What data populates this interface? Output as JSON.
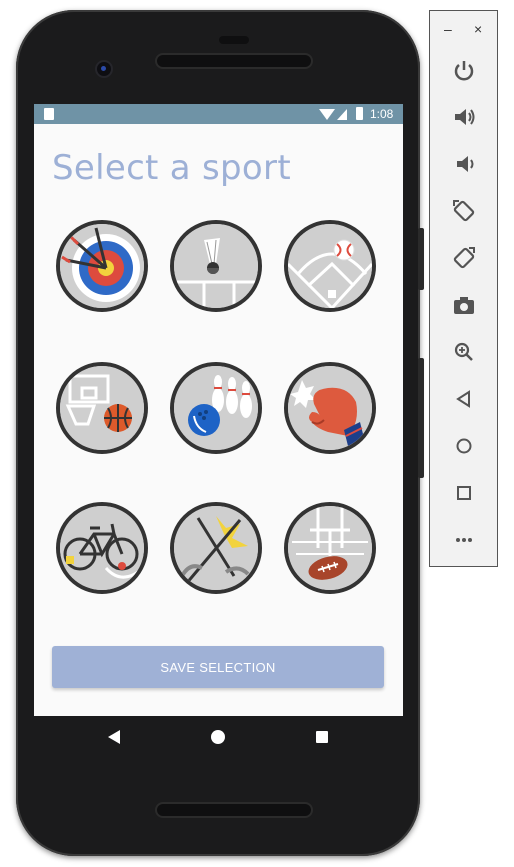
{
  "status_bar": {
    "time": "1:08"
  },
  "page": {
    "title": "Select a sport"
  },
  "sports": [
    {
      "name": "archery"
    },
    {
      "name": "badminton"
    },
    {
      "name": "baseball"
    },
    {
      "name": "basketball"
    },
    {
      "name": "bowling"
    },
    {
      "name": "boxing"
    },
    {
      "name": "cycling"
    },
    {
      "name": "fencing"
    },
    {
      "name": "football"
    }
  ],
  "actions": {
    "save_label": "SAVE SELECTION"
  },
  "emulator_toolbar": {
    "minimize_label": "–",
    "close_label": "×",
    "items": [
      "power",
      "volume-up",
      "volume-down",
      "rotate-left",
      "rotate-right",
      "screenshot",
      "zoom",
      "back",
      "home",
      "overview",
      "more"
    ]
  },
  "colors": {
    "title": "#9db0d6",
    "status_bar": "#6f93a6",
    "button": "#9fb1d6",
    "circle_bg": "#cfcfcf",
    "circle_border": "#333333"
  }
}
